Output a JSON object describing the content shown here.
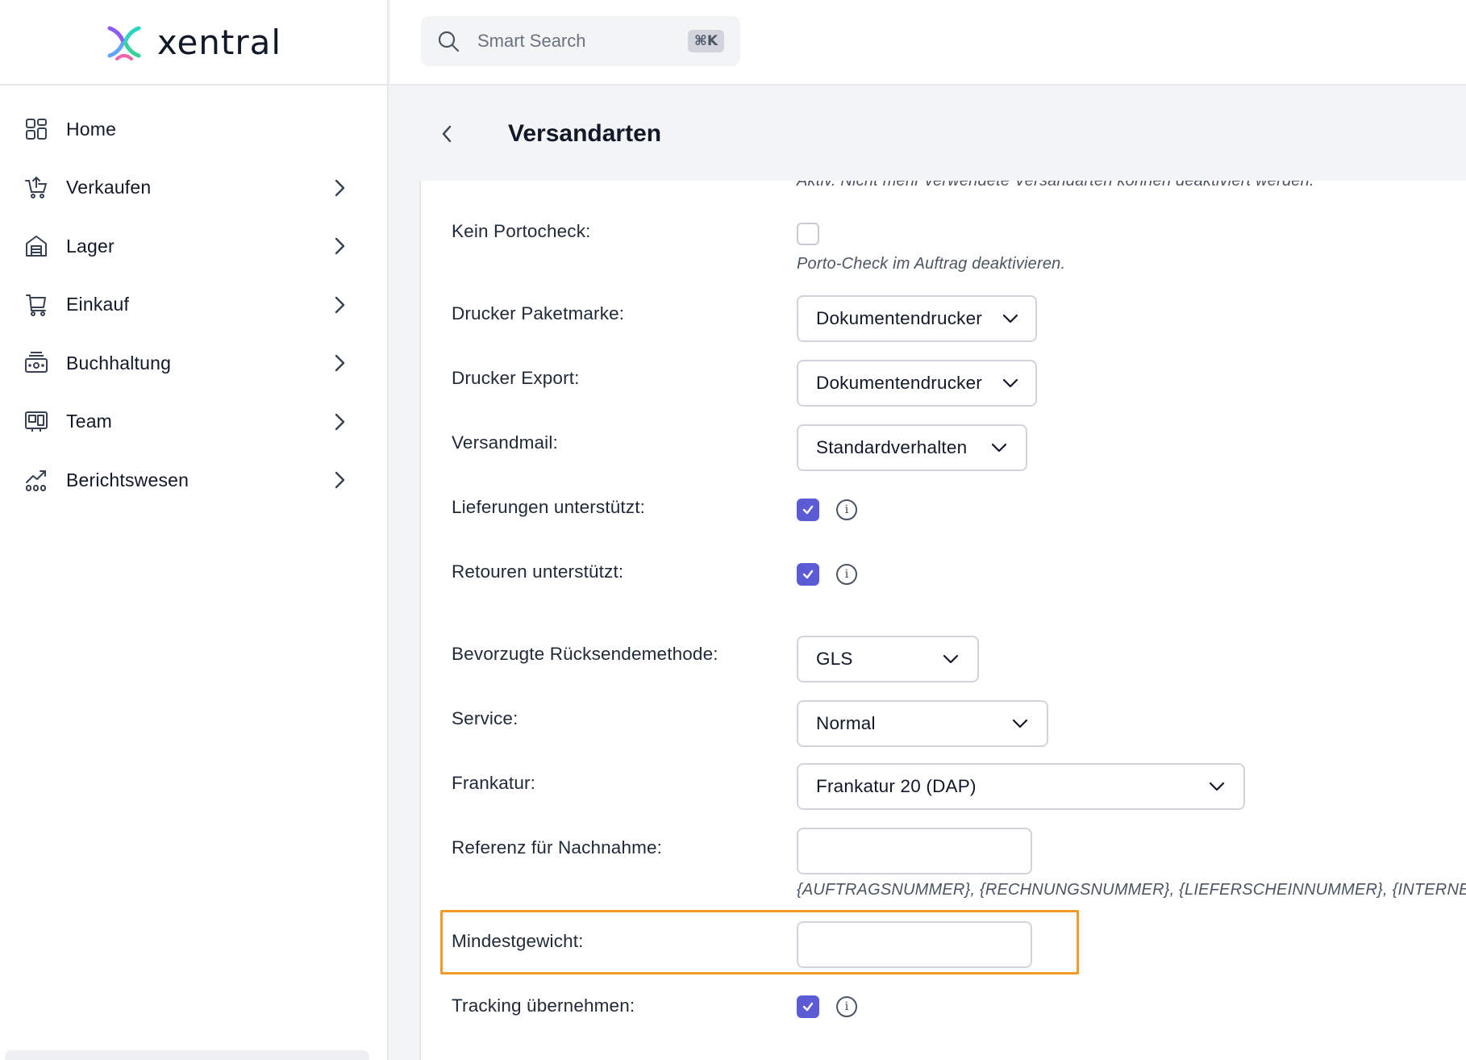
{
  "brand": {
    "name": "xentral"
  },
  "search": {
    "placeholder": "Smart Search",
    "shortcut": "⌘K"
  },
  "sidebar": {
    "items": [
      {
        "label": "Home",
        "icon": "grid-icon",
        "has_children": false
      },
      {
        "label": "Verkaufen",
        "icon": "cart-upload-icon",
        "has_children": true
      },
      {
        "label": "Lager",
        "icon": "warehouse-icon",
        "has_children": true
      },
      {
        "label": "Einkauf",
        "icon": "purchase-cart-icon",
        "has_children": true
      },
      {
        "label": "Buchhaltung",
        "icon": "cash-register-icon",
        "has_children": true
      },
      {
        "label": "Team",
        "icon": "team-board-icon",
        "has_children": true
      },
      {
        "label": "Berichtswesen",
        "icon": "chart-growth-icon",
        "has_children": true
      }
    ]
  },
  "page": {
    "title": "Versandarten"
  },
  "form": {
    "cut_off_help": "Aktiv. Nicht mehr verwendete Versandarten können deaktiviert werden.",
    "kein_portocheck": {
      "label": "Kein Portocheck:",
      "checked": false,
      "help": "Porto-Check im Auftrag deaktivieren."
    },
    "drucker_paketmarke": {
      "label": "Drucker Paketmarke:",
      "value": "Dokumentendrucker"
    },
    "drucker_export": {
      "label": "Drucker Export:",
      "value": "Dokumentendrucker"
    },
    "versandmail": {
      "label": "Versandmail:",
      "value": "Standardverhalten"
    },
    "lieferungen": {
      "label": "Lieferungen unterstützt:",
      "checked": true
    },
    "retouren": {
      "label": "Retouren unterstützt:",
      "checked": true
    },
    "ruecksendemethode": {
      "label": "Bevorzugte Rücksendemethode:",
      "value": "GLS"
    },
    "service": {
      "label": "Service:",
      "value": "Normal"
    },
    "frankatur": {
      "label": "Frankatur:",
      "value": "Frankatur 20 (DAP)"
    },
    "referenz": {
      "label": "Referenz für Nachnahme:",
      "value": "",
      "help": "{AUFTRAGSNUMMER}, {RECHNUNGSNUMMER}, {LIEFERSCHEINNUMMER}, {INTERNET}"
    },
    "mindestgewicht": {
      "label": "Mindestgewicht:",
      "value": "",
      "highlighted": true
    },
    "tracking": {
      "label": "Tracking übernehmen:",
      "checked": true
    }
  },
  "colors": {
    "accent": "#5b5bd6",
    "highlight": "#f29a27",
    "brand_logo": [
      "#7c3aed",
      "#2dd4bf",
      "#ec4899"
    ]
  }
}
